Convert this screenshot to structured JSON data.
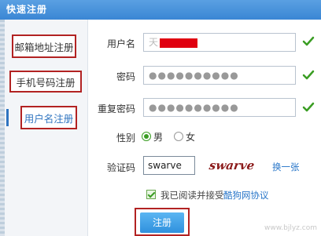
{
  "window": {
    "title": "快速注册"
  },
  "sidebar": {
    "items": [
      {
        "label": "邮箱地址注册"
      },
      {
        "label": "手机号码注册"
      },
      {
        "label": "用户名注册",
        "active": true
      }
    ]
  },
  "form": {
    "username": {
      "label": "用户名",
      "value": "天"
    },
    "password": {
      "label": "密码",
      "value": "●●●●●●●●●●"
    },
    "confirm": {
      "label": "重复密码",
      "value": "●●●●●●●●●●"
    },
    "gender": {
      "label": "性别",
      "male": "男",
      "female": "女",
      "selected": "男"
    },
    "captcha": {
      "label": "验证码",
      "value": "swarve",
      "image_text": "swarve",
      "refresh": "换一张"
    },
    "agree": {
      "text": "我已阅读并接受",
      "link": "酷狗网协议",
      "checked": true
    },
    "submit": "注册"
  },
  "colors": {
    "titlebar": "#3a86d4",
    "accent": "#2a77c9",
    "check": "#3a9d23",
    "highlight_box": "#b22222"
  },
  "watermark": "www.bjlyz.com"
}
